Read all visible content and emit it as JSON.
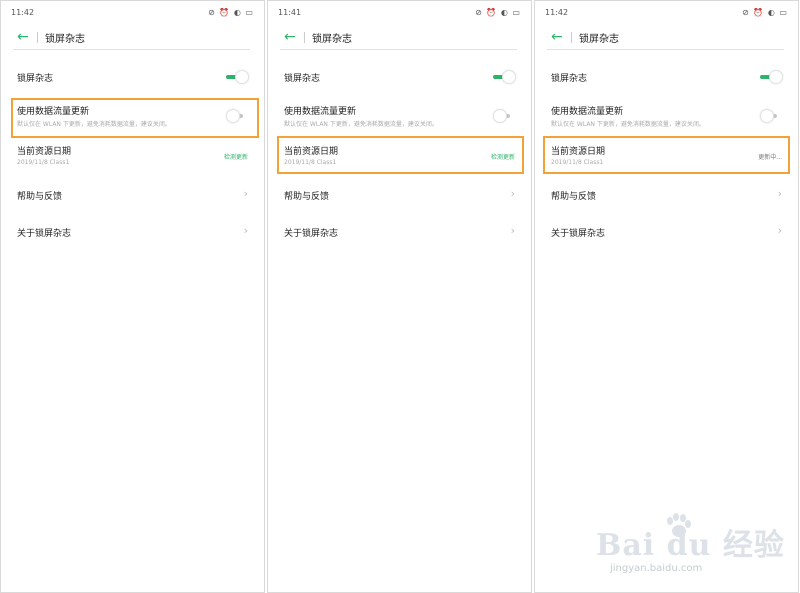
{
  "panels": [
    {
      "time": "11:42",
      "title": "锁屏杂志",
      "switch_label": "锁屏杂志",
      "data_label": "使用数据流量更新",
      "data_desc": "默认仅在 WLAN 下更新，避免消耗数据流量，建议关闭。",
      "resource_label": "当前资源日期",
      "resource_date": "2019/11/8 Class1",
      "resource_action": "检测更新",
      "help": "帮助与反馈",
      "about": "关于锁屏杂志"
    },
    {
      "time": "11:41",
      "title": "锁屏杂志",
      "switch_label": "锁屏杂志",
      "data_label": "使用数据流量更新",
      "data_desc": "默认仅在 WLAN 下更新，避免消耗数据流量，建议关闭。",
      "resource_label": "当前资源日期",
      "resource_date": "2019/11/8 Class1",
      "resource_action": "检测更新",
      "help": "帮助与反馈",
      "about": "关于锁屏杂志"
    },
    {
      "time": "11:42",
      "title": "锁屏杂志",
      "switch_label": "锁屏杂志",
      "data_label": "使用数据流量更新",
      "data_desc": "默认仅在 WLAN 下更新，避免消耗数据流量，建议关闭。",
      "resource_label": "当前资源日期",
      "resource_date": "2019/11/8 Class1",
      "resource_action": "更新中...",
      "help": "帮助与反馈",
      "about": "关于锁屏杂志"
    }
  ],
  "status_icons": "⊘ ⏰ ◐ ▭",
  "colors": {
    "accent": "#2fb36b",
    "highlight": "#f3a23a"
  },
  "watermark": {
    "brand": "Bai du 经验",
    "url": "jingyan.baidu.com"
  }
}
